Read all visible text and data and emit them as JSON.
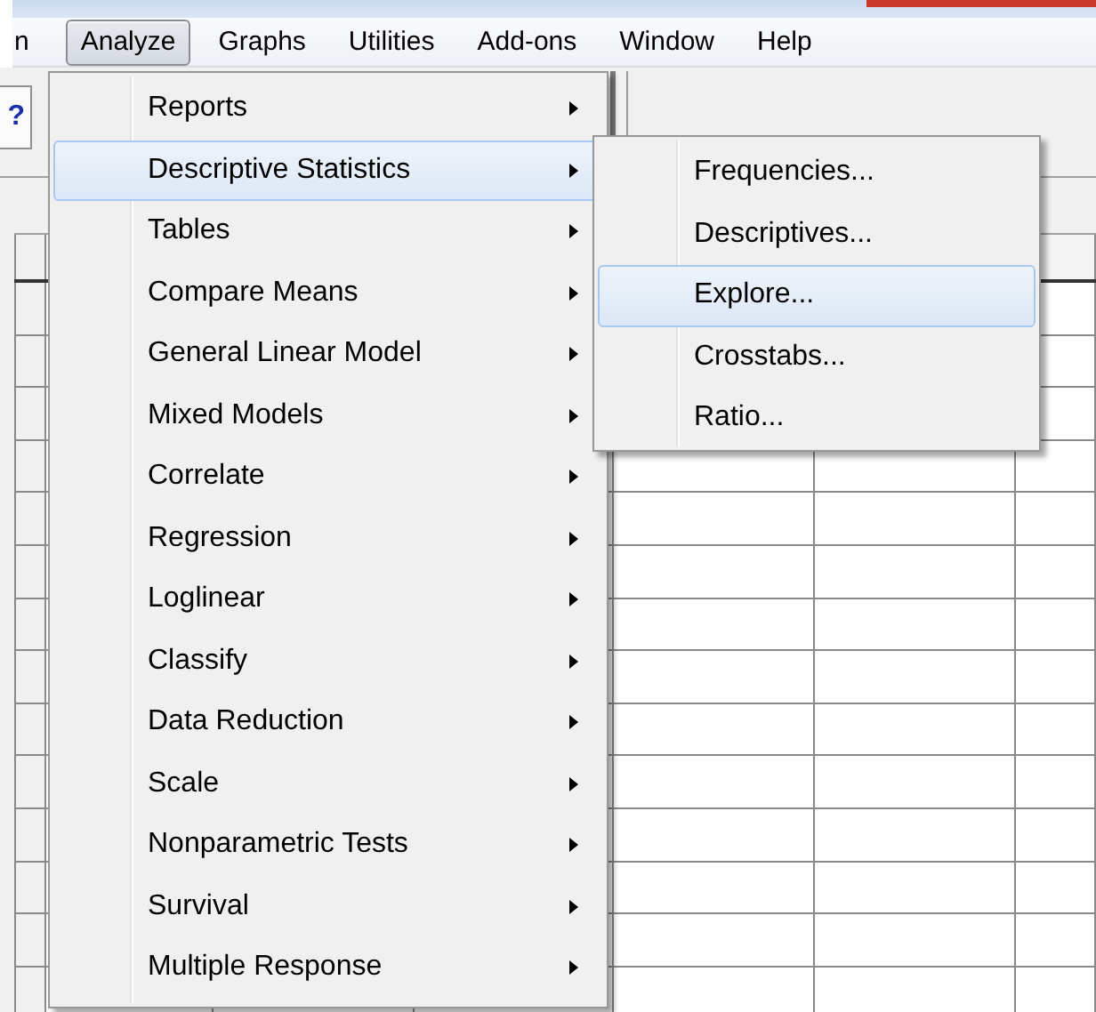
{
  "menubar": [
    {
      "label": "n",
      "selected": false
    },
    {
      "label": "Analyze",
      "selected": true
    },
    {
      "label": "Graphs",
      "selected": false
    },
    {
      "label": "Utilities",
      "selected": false
    },
    {
      "label": "Add-ons",
      "selected": false
    },
    {
      "label": "Window",
      "selected": false
    },
    {
      "label": "Help",
      "selected": false
    }
  ],
  "toolbar": {
    "help_button": "?"
  },
  "menu": {
    "items": [
      {
        "label": "Reports",
        "submenu": true,
        "selected": false
      },
      {
        "label": "Descriptive Statistics",
        "submenu": true,
        "selected": true
      },
      {
        "label": "Tables",
        "submenu": true,
        "selected": false
      },
      {
        "label": "Compare Means",
        "submenu": true,
        "selected": false
      },
      {
        "label": "General Linear Model",
        "submenu": true,
        "selected": false
      },
      {
        "label": "Mixed Models",
        "submenu": true,
        "selected": false
      },
      {
        "label": "Correlate",
        "submenu": true,
        "selected": false
      },
      {
        "label": "Regression",
        "submenu": true,
        "selected": false
      },
      {
        "label": "Loglinear",
        "submenu": true,
        "selected": false
      },
      {
        "label": "Classify",
        "submenu": true,
        "selected": false
      },
      {
        "label": "Data Reduction",
        "submenu": true,
        "selected": false
      },
      {
        "label": "Scale",
        "submenu": true,
        "selected": false
      },
      {
        "label": "Nonparametric Tests",
        "submenu": true,
        "selected": false
      },
      {
        "label": "Survival",
        "submenu": true,
        "selected": false
      },
      {
        "label": "Multiple Response",
        "submenu": true,
        "selected": false
      }
    ]
  },
  "submenu": {
    "items": [
      {
        "label": "Frequencies...",
        "selected": false
      },
      {
        "label": "Descriptives...",
        "selected": false
      },
      {
        "label": "Explore...",
        "selected": true
      },
      {
        "label": "Crosstabs...",
        "selected": false
      },
      {
        "label": "Ratio...",
        "selected": false
      }
    ]
  }
}
